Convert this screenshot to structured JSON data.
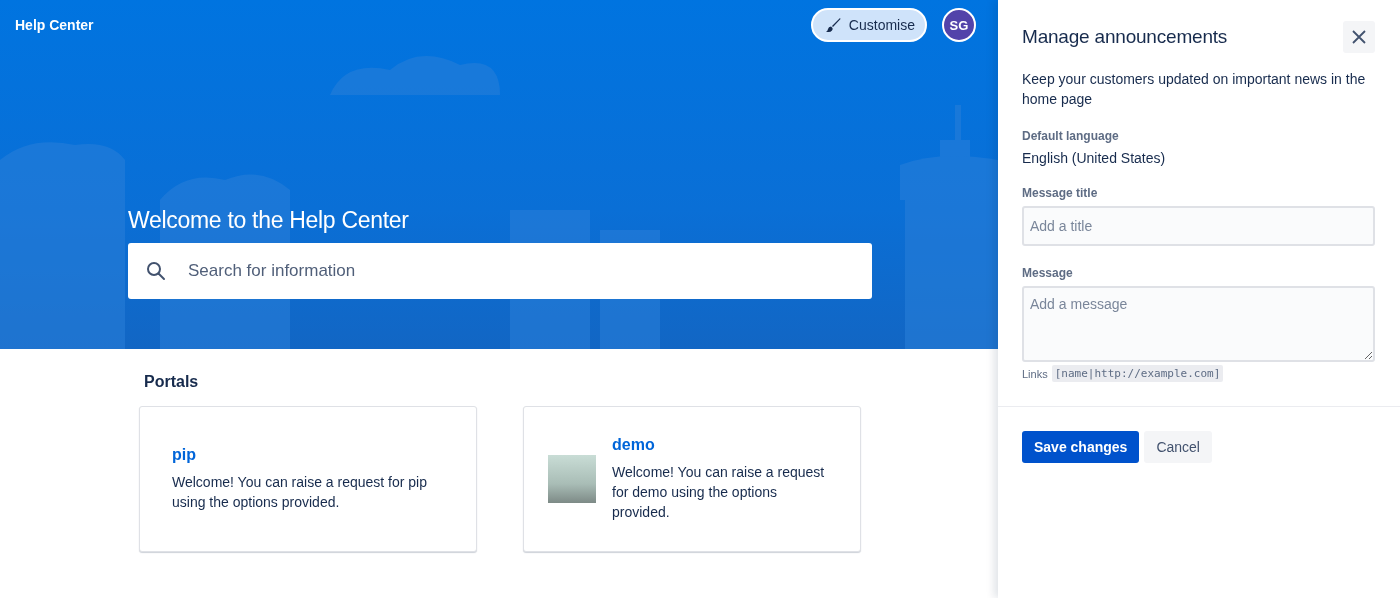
{
  "header": {
    "title": "Help Center",
    "customise_button": "Customise",
    "avatar_initials": "SG"
  },
  "hero": {
    "title": "Welcome to the Help Center",
    "search": {
      "placeholder": "Search for information"
    }
  },
  "portals": {
    "heading": "Portals",
    "cards": [
      {
        "kind": "plain",
        "name": "pip",
        "description": "Welcome! You can raise a request for pip using the options provided."
      },
      {
        "kind": "with-image",
        "name": "demo",
        "description": "Welcome! You can raise a request for demo using the options provided."
      }
    ]
  },
  "panel": {
    "title": "Manage announcements",
    "intro": "Keep your customers updated on important news in the home page",
    "default_language_label": "Default language",
    "default_language": "English (United States)",
    "title_field": {
      "label": "Message title",
      "placeholder": "Add a title"
    },
    "message_field": {
      "label": "Message",
      "placeholder": "Add a message"
    },
    "links_hint": {
      "label": "Links",
      "example": "[name|http://example.com]"
    },
    "buttons": [
      {
        "kind": "primary",
        "label": "Save changes"
      },
      {
        "kind": "subtle",
        "label": "Cancel"
      }
    ]
  }
}
